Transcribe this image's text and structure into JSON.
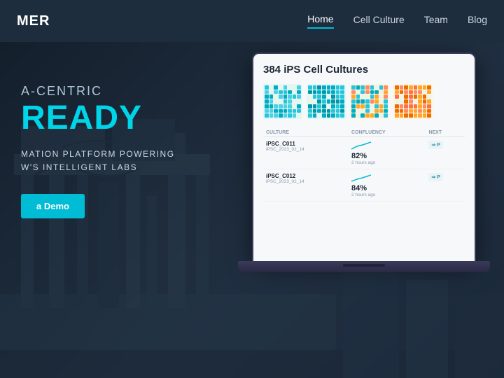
{
  "nav": {
    "logo": "MER",
    "links": [
      {
        "label": "Home",
        "active": true
      },
      {
        "label": "Cell Culture",
        "active": false
      },
      {
        "label": "Team",
        "active": false
      },
      {
        "label": "Blog",
        "active": false
      }
    ]
  },
  "hero": {
    "subtitle": "A-CENTRIC",
    "title": "READY",
    "desc_line1": "MATION PLATFORM POWERING",
    "desc_line2": "W'S INTELLIGENT LABS",
    "cta_label": "a Demo"
  },
  "dashboard": {
    "title": "384 iPS Cell Cultures",
    "grids": [
      {
        "color_scheme": "cyan"
      },
      {
        "color_scheme": "cyan_dense"
      },
      {
        "color_scheme": "orange_cyan"
      },
      {
        "color_scheme": "orange"
      }
    ],
    "table": {
      "columns": [
        "CULTURE",
        "CONFLUENCY",
        "NEXT"
      ],
      "rows": [
        {
          "name": "iPSC_C011",
          "sub": "iPSC_2023_02_14",
          "confluency": "82%",
          "time": "2 hours ago",
          "next": "P"
        },
        {
          "name": "iPSC_C012",
          "sub": "iPSC_2023_02_14",
          "confluency": "84%",
          "time": "2 hours ago",
          "next": "P"
        }
      ]
    }
  },
  "colors": {
    "accent": "#00bcd4",
    "nav_bg": "#1e2d3d",
    "hero_title": "#00d4e8"
  }
}
